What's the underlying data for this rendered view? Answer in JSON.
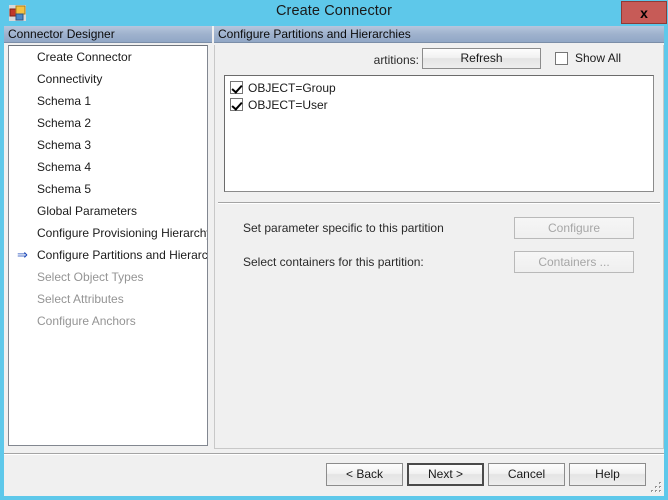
{
  "window": {
    "title": "Create Connector",
    "icon": "connector-designer-icon",
    "close_label": "x",
    "titlebar_color": "#5ec8ea",
    "close_button_color": "#c75b57"
  },
  "sidebar": {
    "header": "Connector Designer",
    "current_step_marker": "⇒",
    "items": [
      {
        "label": "Create Connector",
        "state": "done",
        "current": false
      },
      {
        "label": "Connectivity",
        "state": "done",
        "current": false
      },
      {
        "label": "Schema 1",
        "state": "done",
        "current": false
      },
      {
        "label": "Schema 2",
        "state": "done",
        "current": false
      },
      {
        "label": "Schema 3",
        "state": "done",
        "current": false
      },
      {
        "label": "Schema 4",
        "state": "done",
        "current": false
      },
      {
        "label": "Schema 5",
        "state": "done",
        "current": false
      },
      {
        "label": "Global Parameters",
        "state": "done",
        "current": false
      },
      {
        "label": "Configure Provisioning Hierarchy",
        "state": "done",
        "current": false
      },
      {
        "label": "Configure Partitions and Hierarchies",
        "state": "current",
        "current": true
      },
      {
        "label": "Select Object Types",
        "state": "disabled",
        "current": false
      },
      {
        "label": "Select Attributes",
        "state": "disabled",
        "current": false
      },
      {
        "label": "Configure Anchors",
        "state": "disabled",
        "current": false
      }
    ]
  },
  "main": {
    "header": "Configure Partitions and Hierarchies",
    "partitions_label": "artitions:",
    "refresh_label": "Refresh",
    "show_all": {
      "label": "Show All",
      "checked": false
    },
    "partitions": [
      {
        "label": "OBJECT=Group",
        "checked": true
      },
      {
        "label": "OBJECT=User",
        "checked": true
      }
    ],
    "rows": [
      {
        "label": "Set parameter specific to this partition",
        "button": "Configure",
        "enabled": false
      },
      {
        "label": "Select containers for this partition:",
        "button": "Containers ...",
        "enabled": false
      }
    ]
  },
  "footer": {
    "back_label": "< Back",
    "next_label": "Next  >",
    "cancel_label": "Cancel",
    "help_label": "Help"
  }
}
